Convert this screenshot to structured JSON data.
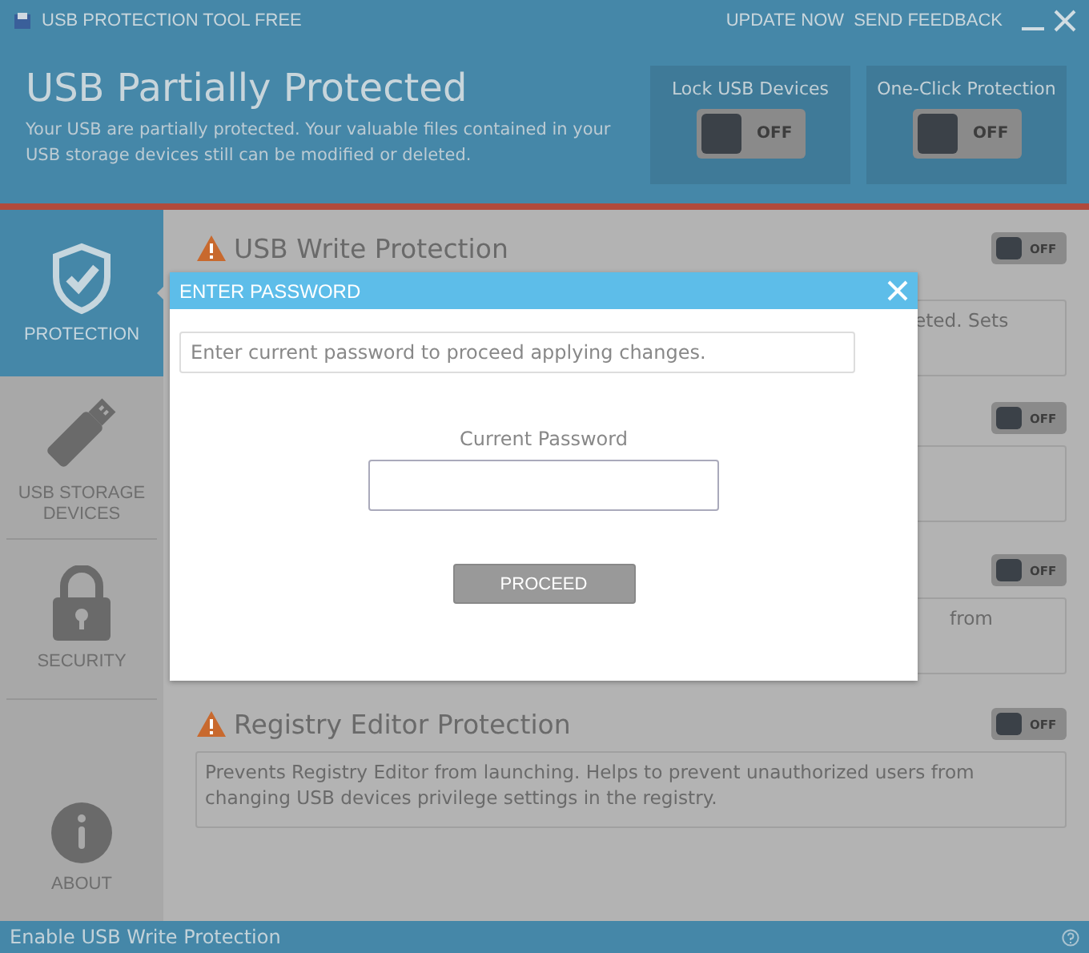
{
  "window": {
    "title": "USB PROTECTION TOOL FREE",
    "links": [
      "UPDATE NOW",
      "SEND FEEDBACK"
    ]
  },
  "header": {
    "title": "USB Partially Protected",
    "subtitle": "Your USB are partially protected. Your valuable files contained in your USB storage devices still can be modified or deleted.",
    "switches": [
      {
        "label": "Lock USB Devices",
        "on": false,
        "state_text": "OFF"
      },
      {
        "label": "One-Click Protection",
        "on": false,
        "state_text": "OFF"
      }
    ]
  },
  "sidebar": {
    "items": [
      {
        "kind": "shield",
        "label": "PROTECTION",
        "selected": true
      },
      {
        "kind": "usb",
        "label": "USB STORAGE DEVICES",
        "selected": false
      },
      {
        "kind": "lock",
        "label": "SECURITY",
        "selected": false
      },
      {
        "kind": "info",
        "label": "ABOUT",
        "selected": false
      }
    ]
  },
  "sections": [
    {
      "title": "USB Write Protection",
      "description": "eted. Sets",
      "covered": true,
      "on": false,
      "state_text": "OFF"
    },
    {
      "on": false,
      "state_text": "OFF"
    },
    {
      "description": "from",
      "covered": true,
      "on": false,
      "state_text": "OFF"
    },
    {
      "title": "Registry Editor Protection",
      "description": "Prevents Registry Editor from launching. Helps to prevent unauthorized users from changing USB devices privilege settings in the registry.",
      "covered": false,
      "on": false,
      "state_text": "OFF"
    }
  ],
  "dialog": {
    "title": "ENTER PASSWORD",
    "message": "Enter current password to proceed applying changes.",
    "field_label": "Current Password",
    "button": "PROCEED"
  },
  "status_bar": {
    "text": "Enable USB Write Protection"
  }
}
